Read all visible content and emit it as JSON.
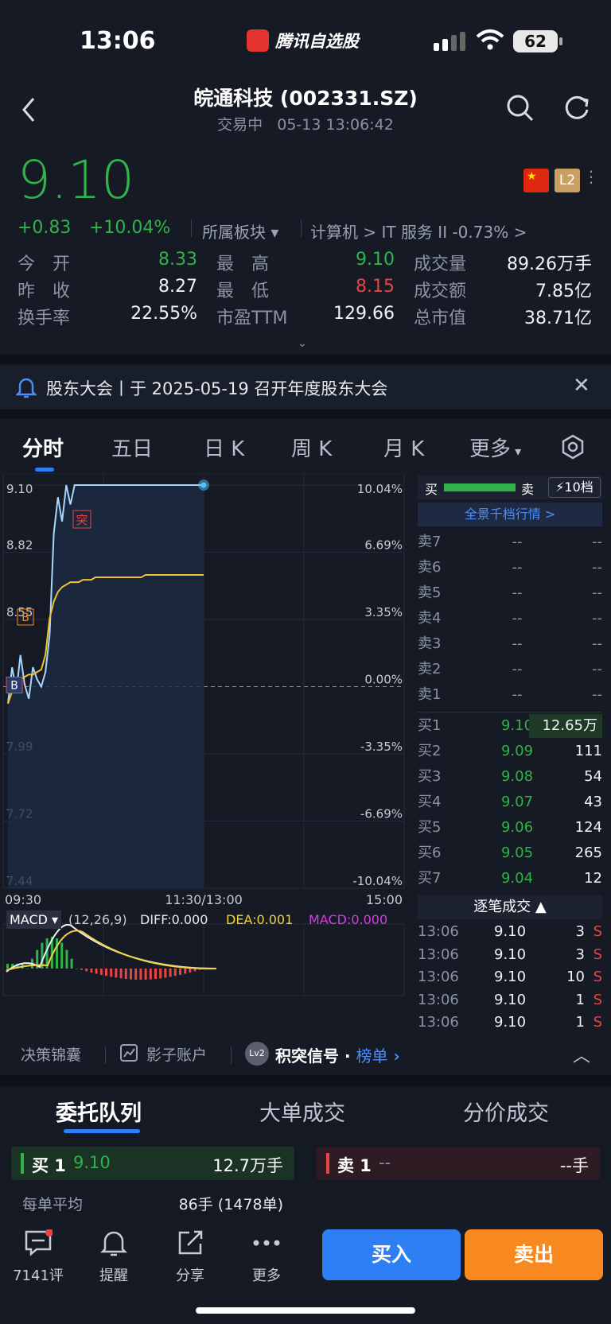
{
  "status": {
    "time": "13:06",
    "app_name": "腾讯自选股",
    "battery": "62"
  },
  "header": {
    "title": "皖通科技 (002331.SZ)",
    "state": "交易中",
    "datetime": "05-13 13:06:42"
  },
  "quote": {
    "price": "9.10",
    "change": "+0.83",
    "change_pct": "+10.04%",
    "sector_label": "所属板块",
    "sector_link": "计算机 > IT 服务 II -0.73% >",
    "badge_l2": "L2",
    "stats": [
      {
        "label": "今　开",
        "value": "8.33",
        "color": "green"
      },
      {
        "label": "最　高",
        "value": "9.10",
        "color": "green"
      },
      {
        "label": "成交量",
        "value": "89.26万手",
        "color": "white"
      },
      {
        "label": "昨　收",
        "value": "8.27",
        "color": "white"
      },
      {
        "label": "最　低",
        "value": "8.15",
        "color": "red"
      },
      {
        "label": "成交额",
        "value": "7.85亿",
        "color": "white"
      },
      {
        "label": "换手率",
        "value": "22.55%",
        "color": "white"
      },
      {
        "label": "市盈TTM",
        "value": "129.66",
        "color": "white"
      },
      {
        "label": "总市值",
        "value": "38.71亿",
        "color": "white"
      }
    ]
  },
  "notice": {
    "text": "股东大会丨于 2025-05-19 召开年度股东大会"
  },
  "tabs": [
    "分时",
    "五日",
    "日 K",
    "周 K",
    "月 K",
    "更多"
  ],
  "chart_data": {
    "type": "line",
    "y_left_ticks": [
      "9.10",
      "8.82",
      "8.55",
      "",
      "7.99",
      "7.72",
      "7.44"
    ],
    "y_right_ticks": [
      "10.04%",
      "6.69%",
      "3.35%",
      "0.00%",
      "-3.35%",
      "-6.69%",
      "-10.04%"
    ],
    "x_ticks": [
      "09:30",
      "11:30/13:00",
      "15:00"
    ],
    "ylim": [
      7.44,
      9.1
    ],
    "prev_close": 8.27,
    "series": [
      {
        "values": [
          8.2,
          8.35,
          8.25,
          8.4,
          8.28,
          8.22,
          8.35,
          8.3,
          8.27,
          8.33,
          8.48,
          8.9,
          9.05,
          8.95,
          9.1,
          9.02,
          9.1,
          9.1,
          9.1,
          9.1,
          9.1,
          9.1,
          9.1,
          9.1,
          9.1,
          9.1,
          9.1,
          9.1,
          9.1,
          9.1,
          9.1,
          9.1,
          9.1,
          9.1,
          9.1,
          9.1,
          9.1,
          9.1,
          9.1,
          9.1,
          9.1,
          9.1,
          9.1,
          9.1,
          9.1,
          9.1,
          9.1,
          9.1
        ]
      },
      {
        "values": [
          8.2,
          8.25,
          8.28,
          8.3,
          8.31,
          8.32,
          8.32,
          8.33,
          8.34,
          8.4,
          8.55,
          8.62,
          8.66,
          8.68,
          8.69,
          8.7,
          8.7,
          8.7,
          8.71,
          8.71,
          8.71,
          8.72,
          8.72,
          8.72,
          8.72,
          8.72,
          8.72,
          8.72,
          8.72,
          8.72,
          8.72,
          8.72,
          8.72,
          8.73,
          8.73,
          8.73,
          8.73,
          8.73,
          8.73,
          8.73,
          8.73,
          8.73,
          8.73,
          8.73,
          8.73,
          8.73,
          8.73,
          8.73
        ]
      }
    ],
    "markers": [
      "突",
      "B",
      "B"
    ],
    "macd": {
      "name": "MACD",
      "params": "(12,26,9)",
      "diff": "DIFF:0.000",
      "dea": "DEA:0.001",
      "macd": "MACD:0.000"
    }
  },
  "orderbook": {
    "top": {
      "buy": "买",
      "sell": "卖",
      "level": "10档",
      "link": "全景千档行情 >"
    },
    "asks": [
      {
        "label": "卖7",
        "price": "--",
        "vol": "--"
      },
      {
        "label": "卖6",
        "price": "--",
        "vol": "--"
      },
      {
        "label": "卖5",
        "price": "--",
        "vol": "--"
      },
      {
        "label": "卖4",
        "price": "--",
        "vol": "--"
      },
      {
        "label": "卖3",
        "price": "--",
        "vol": "--"
      },
      {
        "label": "卖2",
        "price": "--",
        "vol": "--"
      },
      {
        "label": "卖1",
        "price": "--",
        "vol": "--"
      }
    ],
    "bids": [
      {
        "label": "买1",
        "price": "9.10",
        "vol": "12.65万"
      },
      {
        "label": "买2",
        "price": "9.09",
        "vol": "111"
      },
      {
        "label": "买3",
        "price": "9.08",
        "vol": "54"
      },
      {
        "label": "买4",
        "price": "9.07",
        "vol": "43"
      },
      {
        "label": "买5",
        "price": "9.06",
        "vol": "124"
      },
      {
        "label": "买6",
        "price": "9.05",
        "vol": "265"
      },
      {
        "label": "买7",
        "price": "9.04",
        "vol": "12"
      }
    ],
    "ticks_title": "逐笔成交",
    "ticks": [
      {
        "time": "13:06",
        "price": "9.10",
        "vol": "3",
        "side": "S"
      },
      {
        "time": "13:06",
        "price": "9.10",
        "vol": "3",
        "side": "S"
      },
      {
        "time": "13:06",
        "price": "9.10",
        "vol": "10",
        "side": "S"
      },
      {
        "time": "13:06",
        "price": "9.10",
        "vol": "1",
        "side": "S"
      },
      {
        "time": "13:06",
        "price": "9.10",
        "vol": "1",
        "side": "S"
      }
    ]
  },
  "toolbar": {
    "item1": "决策锦囊",
    "item2": "影子账户",
    "item3": "积突信号",
    "item3_link": "榜单",
    "badge": "Lv2"
  },
  "panel": {
    "tabs": [
      "委托队列",
      "大单成交",
      "分价成交"
    ],
    "buy1_label": "买 1",
    "buy1_price": "9.10",
    "buy1_vol": "12.7万手",
    "sell1_label": "卖 1",
    "sell1_price": "--",
    "sell1_vol": "--手",
    "avg_label": "每单平均",
    "avg_value": "86手 (1478单)"
  },
  "bottom": {
    "comments": "7141评",
    "remind": "提醒",
    "share": "分享",
    "more": "更多",
    "buy": "买入",
    "sell": "卖出"
  }
}
